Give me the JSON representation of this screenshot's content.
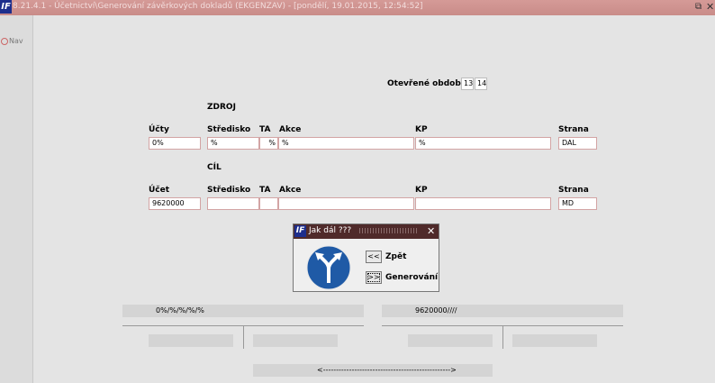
{
  "window": {
    "title": "8.21.4.1 - Účetnictví\\Generování závěrkových dokladů (EKGENZAV) - [pondělí, 19.01.2015, 12:54:52]",
    "logo": "IF"
  },
  "nav": {
    "label": "Nav"
  },
  "period": {
    "label": "Otevřené období",
    "from": "13",
    "to": "14"
  },
  "source": {
    "section_title": "ZDROJ",
    "labels": {
      "ucty": "Účty",
      "stredisko": "Středisko",
      "ta": "TA",
      "akce": "Akce",
      "kp": "KP",
      "strana": "Strana"
    },
    "values": {
      "ucty": "0%",
      "stredisko": "%",
      "ta": "%",
      "akce": "%",
      "kp": "%",
      "strana": "DAL"
    }
  },
  "target": {
    "section_title": "CÍL",
    "labels": {
      "ucet": "Účet",
      "stredisko": "Středisko",
      "ta": "TA",
      "akce": "Akce",
      "kp": "KP",
      "strana": "Strana"
    },
    "values": {
      "ucet": "9620000",
      "stredisko": "",
      "ta": "",
      "akce": "",
      "kp": "",
      "strana": "MD"
    }
  },
  "summary": {
    "source_mask": "0%/%/%/%/%",
    "target_mask": "9620000////",
    "bottom_arrow": "<------------------------------------------------->"
  },
  "dialog": {
    "logo": "IF",
    "title": "Jak dál ???",
    "close": "✕",
    "back_button": "<<",
    "back_label": "Zpět",
    "generate_button": ">>",
    "generate_label": "Generování",
    "icon": "fork-arrow-sign-icon",
    "icon_color": "#1f5aa6"
  }
}
